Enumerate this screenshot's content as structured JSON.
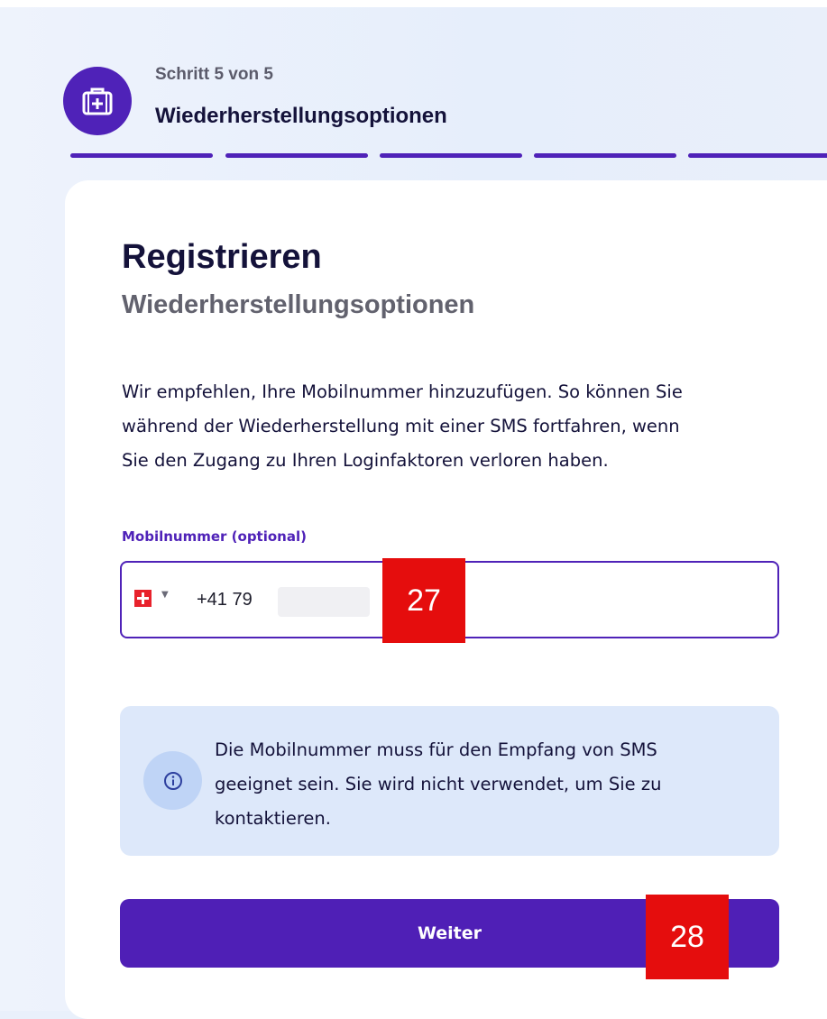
{
  "header": {
    "step_label": "Schritt 5 von 5",
    "step_title": "Wiederherstellungsoptionen",
    "progress_segments": 5
  },
  "card": {
    "title": "Registrieren",
    "subtitle": "Wiederherstellungsoptionen",
    "intro_line1": "Wir empfehlen, Ihre Mobilnummer hinzuzufügen. So können Sie",
    "intro_line2": "während der Wiederherstellung mit einer SMS fortfahren, wenn",
    "intro_line3": "Sie den Zugang zu Ihren Loginfaktoren verloren haben."
  },
  "phone": {
    "label": "Mobilnummer (optional)",
    "country_icon": "swiss-flag-icon",
    "value_prefix": "+41 79"
  },
  "info": {
    "icon": "info-icon",
    "line1": "Die Mobilnummer muss für den Empfang von SMS",
    "line2": "geeignet sein. Sie wird nicht verwendet, um Sie zu",
    "line3": "kontaktieren."
  },
  "submit": {
    "label": "Weiter"
  },
  "markers": [
    "27",
    "28"
  ],
  "colors": {
    "accent": "#4f22b8",
    "text_dark": "#14123a",
    "info_bg": "#dde8fa",
    "marker_red": "#e50d0d"
  }
}
